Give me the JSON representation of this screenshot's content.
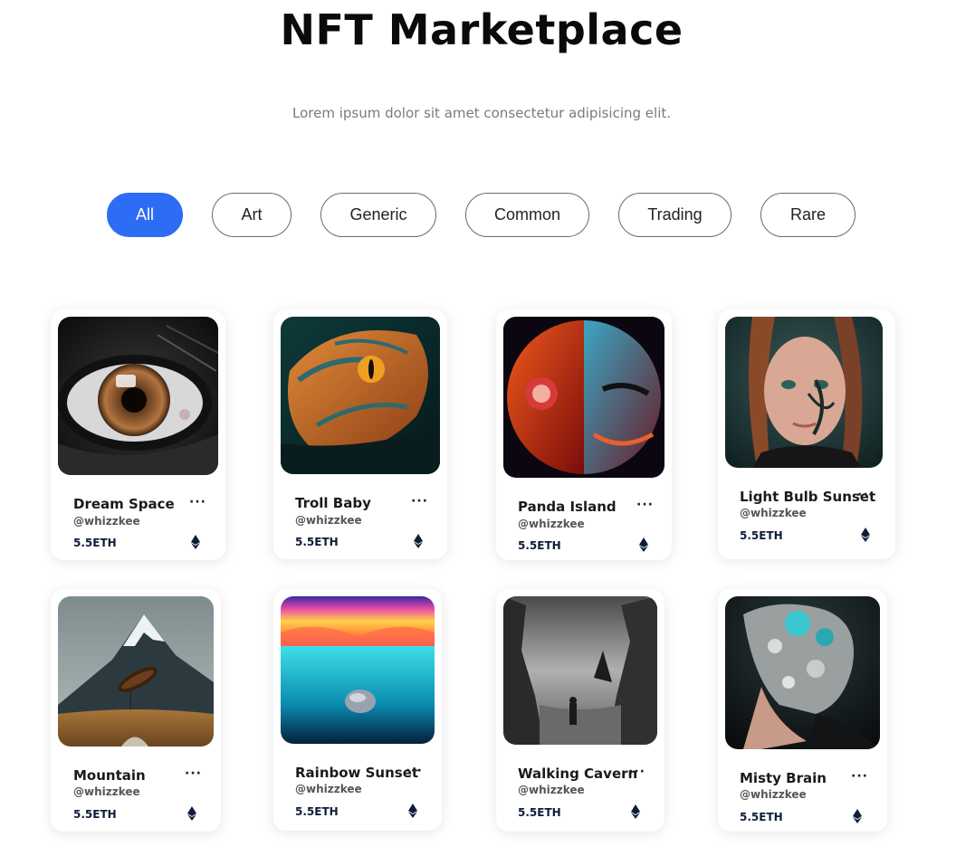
{
  "header": {
    "title": "NFT Marketplace",
    "subtitle": "Lorem ipsum dolor sit amet consectetur adipisicing elit."
  },
  "filters": [
    {
      "label": "All",
      "active": true
    },
    {
      "label": "Art",
      "active": false
    },
    {
      "label": "Generic",
      "active": false
    },
    {
      "label": "Common",
      "active": false
    },
    {
      "label": "Trading",
      "active": false
    },
    {
      "label": "Rare",
      "active": false
    }
  ],
  "colors": {
    "accent": "#2d6cf5",
    "eth_icon": "#0f1d3a"
  },
  "more_label": "···",
  "cards": [
    {
      "name": "Dream Space",
      "handle": "@whizzkee",
      "price": "5.5ETH",
      "image": "close-up eye artwork"
    },
    {
      "name": "Troll Baby",
      "handle": "@whizzkee",
      "price": "5.5ETH",
      "image": "orange reptile creature"
    },
    {
      "name": "Panda Island",
      "handle": "@whizzkee",
      "price": "5.5ETH",
      "image": "red and blue split face sphere"
    },
    {
      "name": "Light Bulb Sunset",
      "handle": "@whizzkee",
      "price": "5.5ETH",
      "image": "child portrait with face paint"
    },
    {
      "name": "Mountain",
      "handle": "@whizzkee",
      "price": "5.5ETH",
      "image": "snowy mountain with floating seed"
    },
    {
      "name": "Rainbow Sunset",
      "handle": "@whizzkee",
      "price": "5.5ETH",
      "image": "rainbow sky over turquoise water"
    },
    {
      "name": "Walking Cavern",
      "handle": "@whizzkee",
      "price": "5.5ETH",
      "image": "misty canyon with figure"
    },
    {
      "name": "Misty Brain",
      "handle": "@whizzkee",
      "price": "5.5ETH",
      "image": "dissolving head portrait"
    }
  ]
}
